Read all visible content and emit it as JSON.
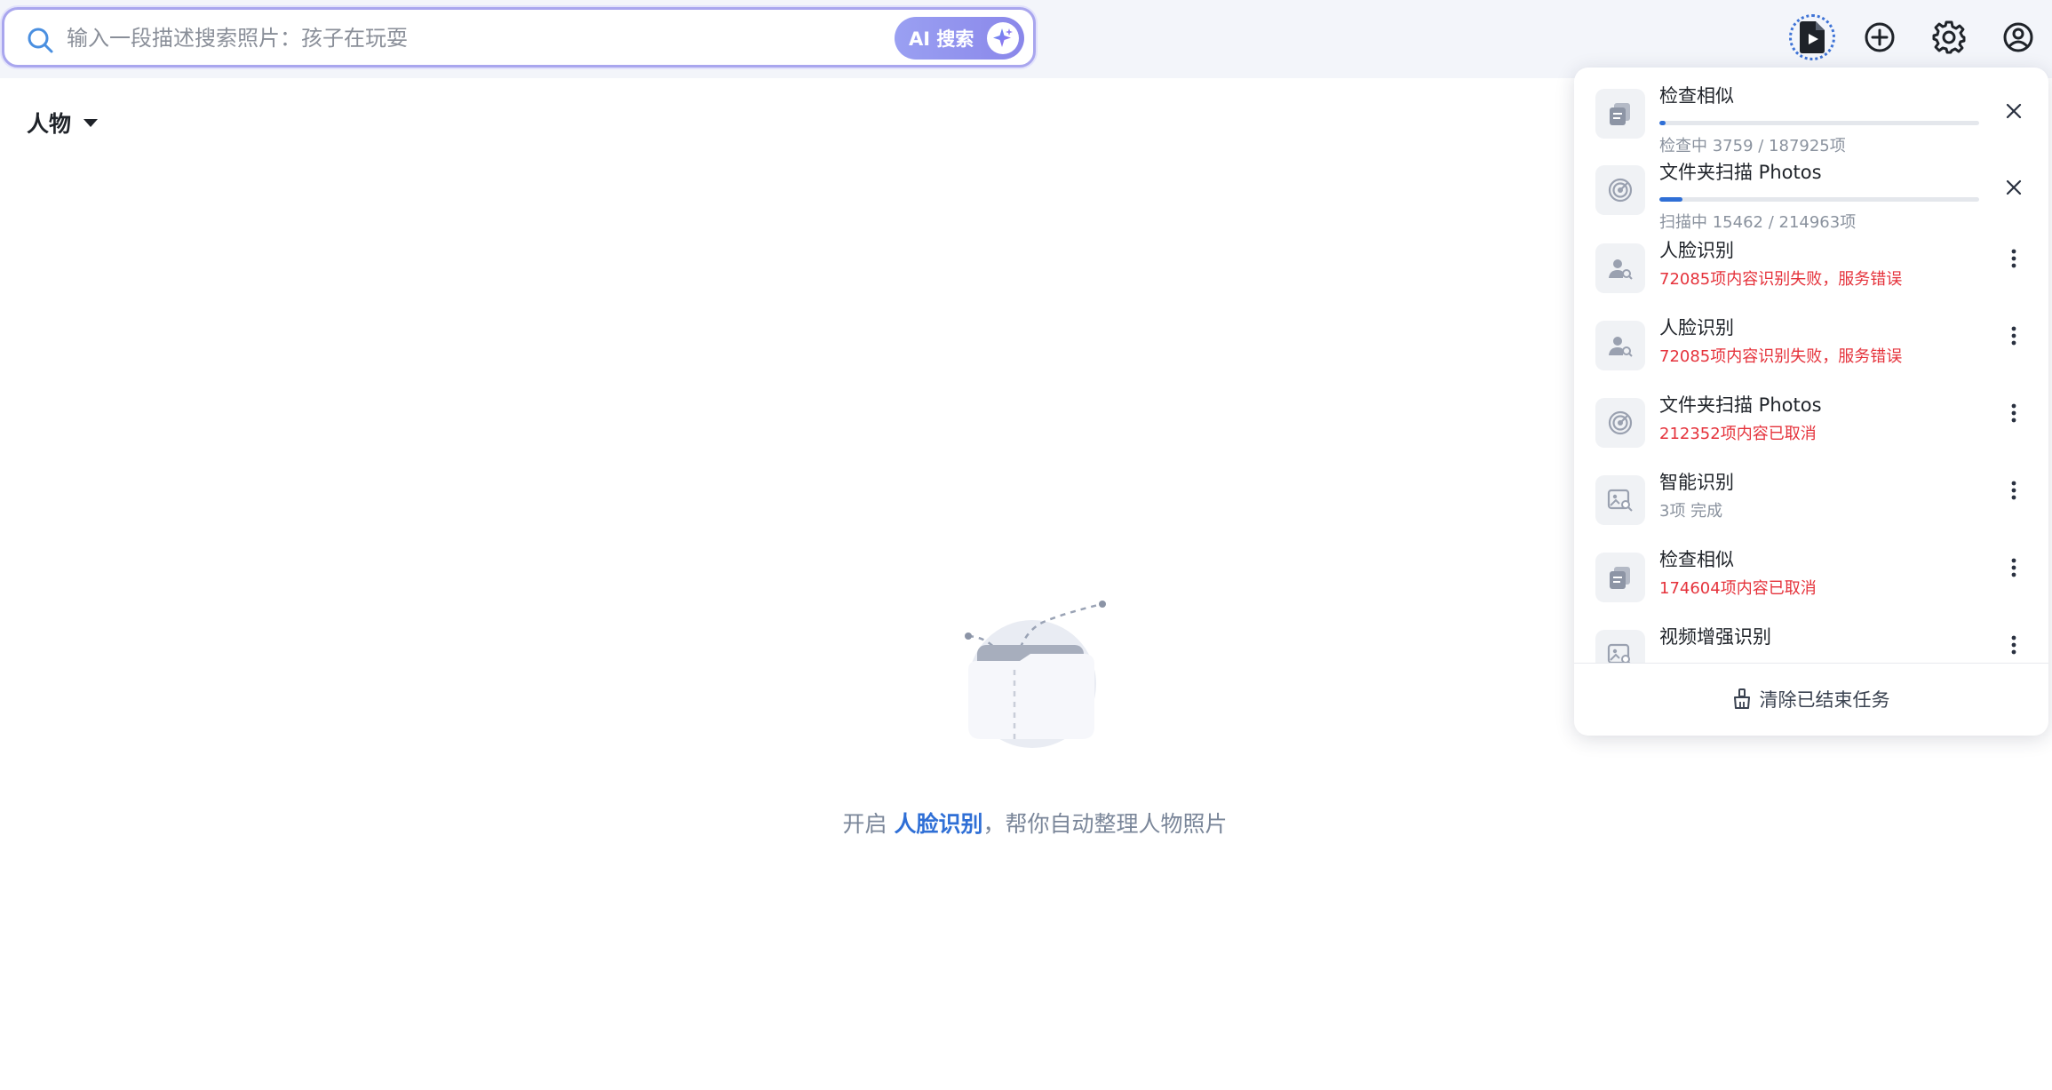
{
  "search": {
    "placeholder": "输入一段描述搜索照片：孩子在玩耍",
    "ai_button_label": "AI 搜索"
  },
  "header_icons": [
    "task-icon",
    "add-icon",
    "gear-icon",
    "user-icon"
  ],
  "main": {
    "category_label": "人物",
    "empty_hint": {
      "prefix": "开启 ",
      "link": "人脸识别",
      "suffix": "，帮你自动整理人物照片"
    }
  },
  "tasks": {
    "items": [
      {
        "title": "检查相似",
        "subtitle": "检查中 3759 / 187925项",
        "status": "running",
        "progress": 0.02,
        "icon": "duplicate-icon",
        "action": "close-icon"
      },
      {
        "title": "文件夹扫描 Photos",
        "subtitle": "扫描中 15462 / 214963项",
        "status": "running",
        "progress": 0.072,
        "icon": "radar-icon",
        "action": "close-icon"
      },
      {
        "title": "人脸识别",
        "subtitle": "72085项内容识别失败，服务错误",
        "status": "error",
        "icon": "face-search-icon",
        "action": "more-icon"
      },
      {
        "title": "人脸识别",
        "subtitle": "72085项内容识别失败，服务错误",
        "status": "error",
        "icon": "face-search-icon",
        "action": "more-icon"
      },
      {
        "title": "文件夹扫描 Photos",
        "subtitle": "212352项内容已取消",
        "status": "error",
        "icon": "radar-icon",
        "action": "more-icon"
      },
      {
        "title": "智能识别",
        "subtitle": "3项 完成",
        "status": "done",
        "icon": "image-search-icon",
        "action": "more-icon"
      },
      {
        "title": "检查相似",
        "subtitle": "174604项内容已取消",
        "status": "error",
        "icon": "duplicate-icon",
        "action": "more-icon"
      },
      {
        "title": "视频增强识别",
        "subtitle": "",
        "status": "partial",
        "icon": "image-search-icon",
        "action": "more-icon"
      }
    ],
    "clear_label": "清除已结束任务"
  },
  "colors": {
    "accent": "#2f6fd6",
    "error": "#e5323b",
    "ai_gradient_start": "#9aa0f2",
    "ai_gradient_end": "#8a87ea"
  }
}
